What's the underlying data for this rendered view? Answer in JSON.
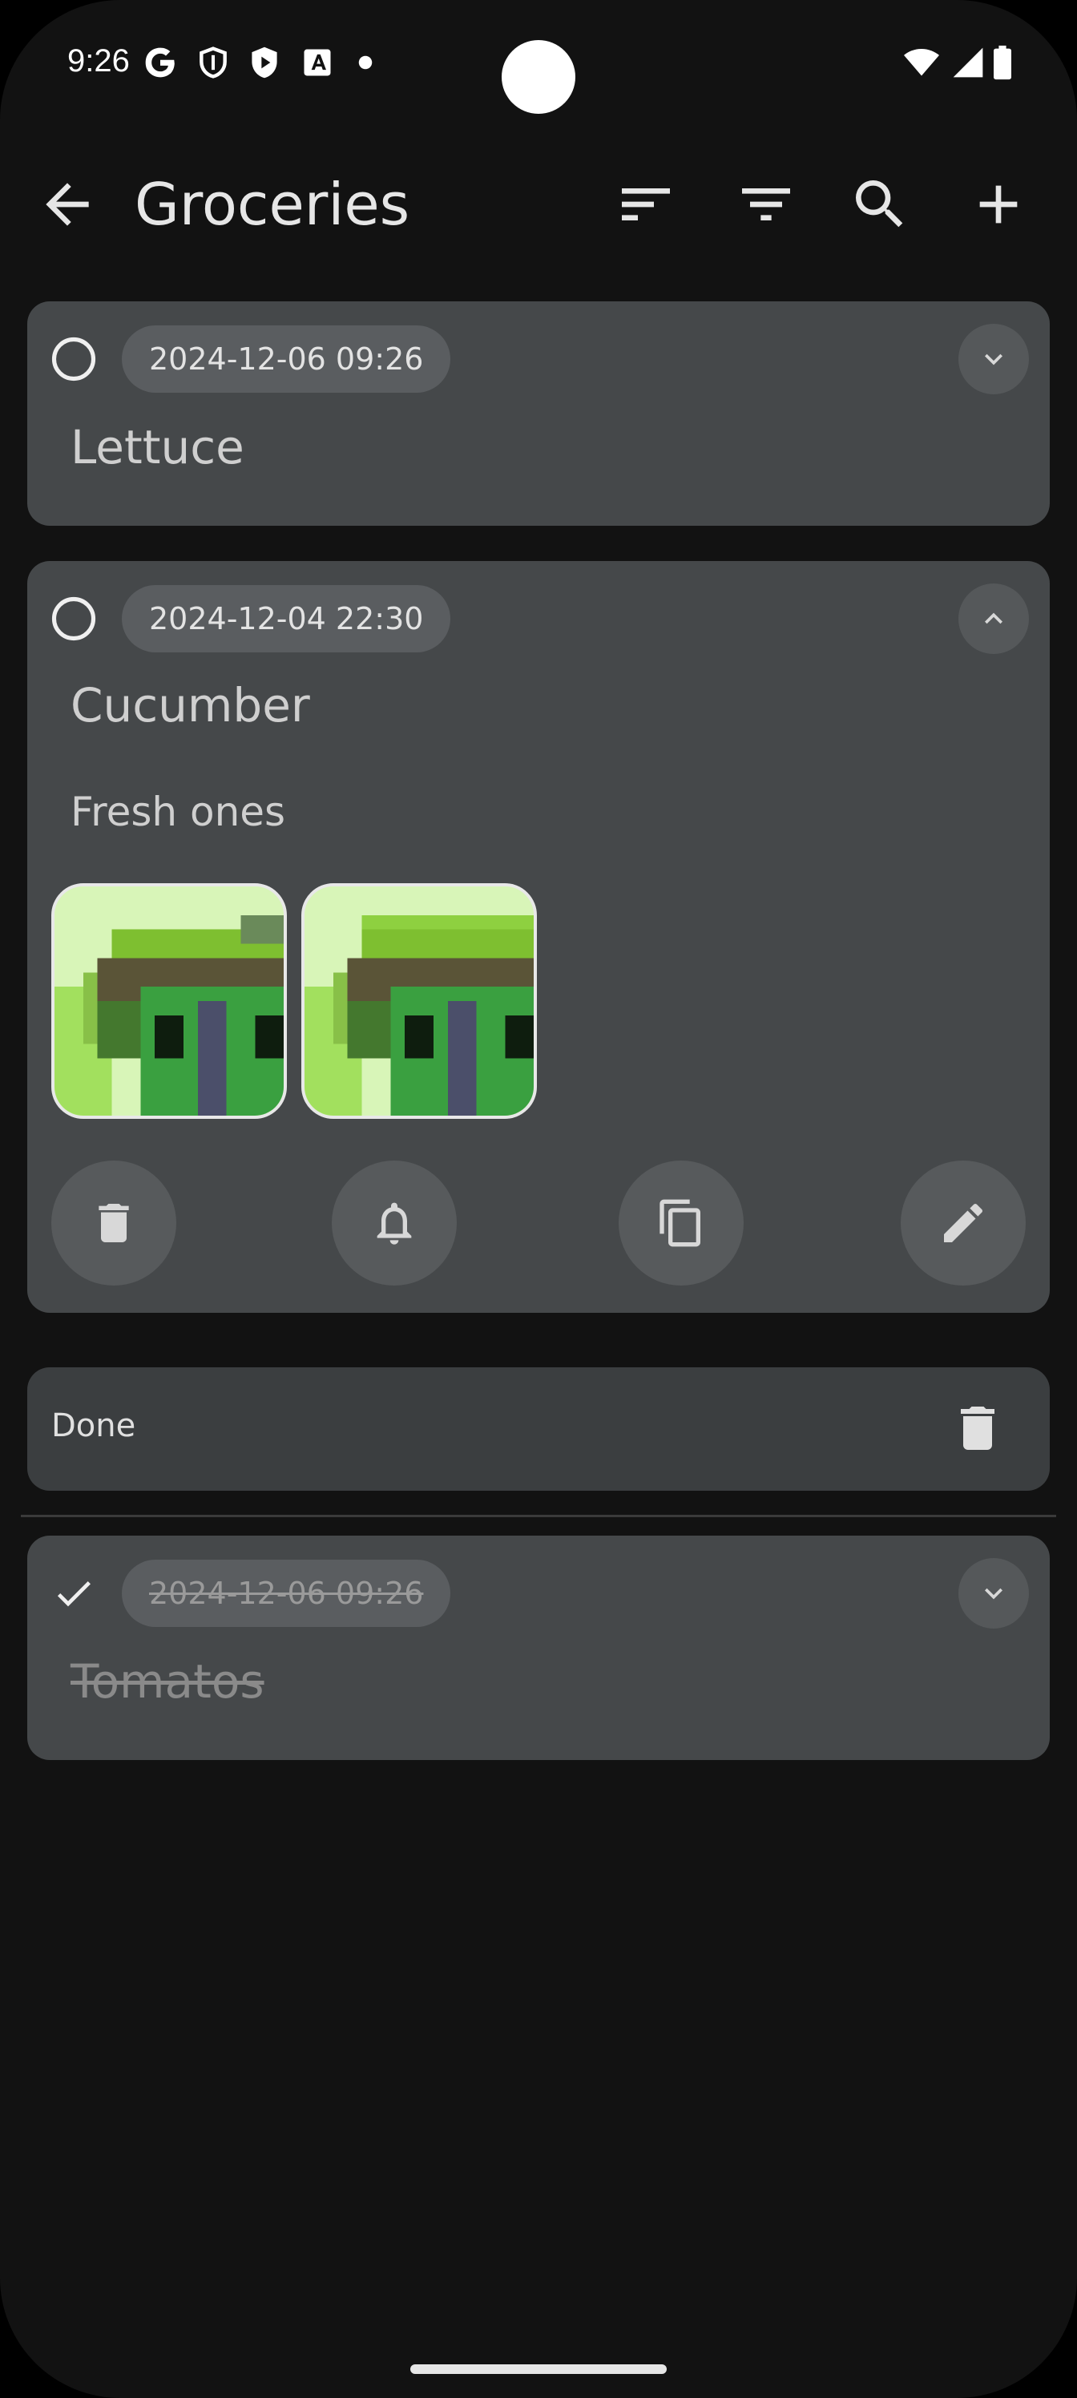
{
  "status_bar": {
    "time": "9:26",
    "left_icons": [
      "google-icon",
      "shield-icon",
      "play-protect-icon",
      "accessibility-icon",
      "dot-icon"
    ],
    "right_icons": [
      "wifi-icon",
      "signal-icon",
      "battery-icon"
    ]
  },
  "app_bar": {
    "title": "Groceries",
    "actions": [
      "sort-icon",
      "filter-icon",
      "search-icon",
      "add-icon"
    ]
  },
  "items": [
    {
      "date": "2024-12-06 09:26",
      "title": "Lettuce",
      "checked": false,
      "expanded": false
    },
    {
      "date": "2024-12-04 22:30",
      "title": "Cucumber",
      "description": "Fresh ones",
      "checked": false,
      "expanded": true,
      "attachments": [
        "image-1",
        "image-2"
      ],
      "actions": [
        "delete-icon",
        "bell-icon",
        "copy-icon",
        "edit-icon"
      ]
    }
  ],
  "done_section": {
    "label": "Done"
  },
  "done_items": [
    {
      "date": "2024-12-06 09:26",
      "title": "Tomatos",
      "checked": true,
      "expanded": false
    }
  ],
  "colors": {
    "background": "#121212",
    "card": "#45484a",
    "chip": "#5a5d60",
    "done_bar": "#3b3e40"
  }
}
